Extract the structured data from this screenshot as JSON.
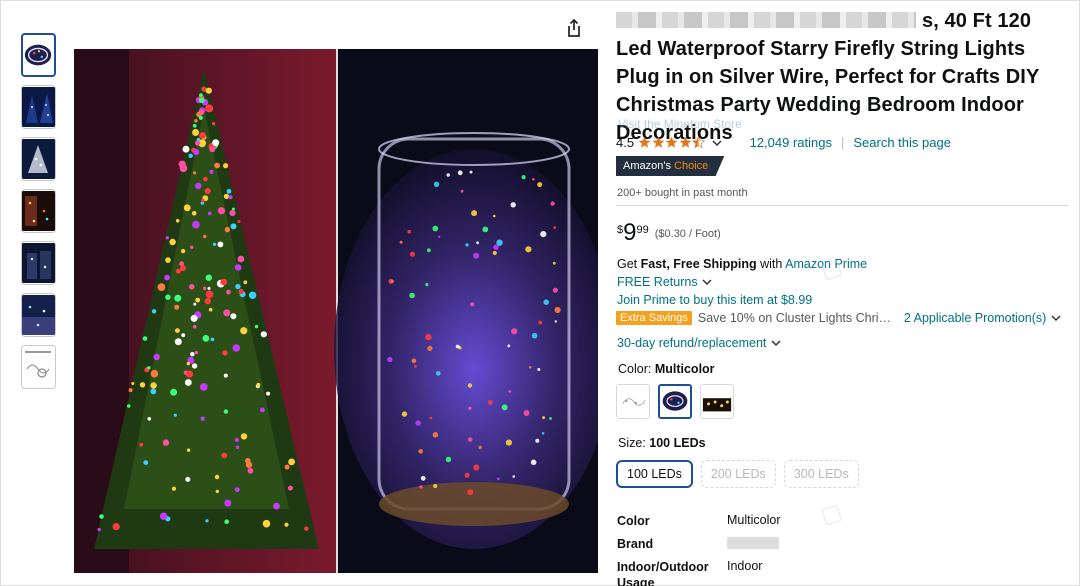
{
  "product": {
    "title_visible": "s, 40 Ft 120 Led Waterproof Starry Firefly String Lights Plug in on Silver Wire, Perfect for Crafts DIY Christmas Party Wedding Bedroom Indoor Decorations",
    "title_line1": "s, 40 Ft 120 Led",
    "title_rest": "Waterproof Starry Firefly String Lights Plug in on Silver Wire, Perfect for Crafts DIY Christmas Party Wedding Bedroom Indoor Decorations",
    "store_link": "Visit the Minetom Store"
  },
  "rating": {
    "value": "4.5",
    "stars_out_of_5": 4.5,
    "count_text": "12,049 ratings",
    "search_link": "Search this page"
  },
  "badge": {
    "prefix": "Amazon's",
    "choice": "Choice"
  },
  "bought_text": "200+ bought in past month",
  "price": {
    "symbol": "$",
    "whole": "9",
    "fraction": "99",
    "unit_price": "($0.30 / Foot)"
  },
  "shipping": {
    "get": "Get ",
    "bold": "Fast, Free Shipping",
    "with": " with ",
    "prime_link": "Amazon Prime"
  },
  "returns_text": "FREE Returns",
  "join_prime_text": "Join Prime to buy this item at $8.99",
  "savings": {
    "tag": "Extra Savings",
    "text": "Save 10% on Cluster Lights Chris…",
    "promo_link": "2 Applicable Promotion(s)"
  },
  "refund_text": "30-day refund/replacement",
  "color": {
    "label": "Color: ",
    "selected": "Multicolor",
    "options": [
      "silver-white",
      "multicolor",
      "warm-white"
    ]
  },
  "size": {
    "label": "Size: ",
    "selected": "100 LEDs",
    "options": [
      "100 LEDs",
      "200 LEDs",
      "300 LEDs"
    ]
  },
  "specs": [
    {
      "key": "Color",
      "value": "Multicolor"
    },
    {
      "key": "Brand",
      "value": ""
    },
    {
      "key": "Indoor/Outdoor Usage",
      "value": "Indoor"
    }
  ],
  "colors": {
    "link": "#007185",
    "selected_border": "#1e4e9a",
    "badge_bg": "#232f3e",
    "badge_accent": "#f08804",
    "star": "#de7921",
    "savings_tag": "#f4a11d"
  },
  "icons": {
    "share": "share-icon",
    "chevron": "chevron-down-icon",
    "star": "star-icon"
  }
}
